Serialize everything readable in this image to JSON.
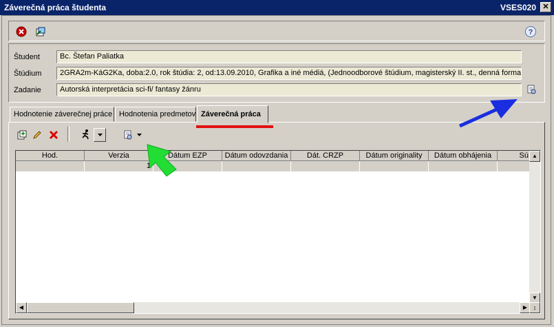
{
  "window": {
    "title": "Záverečná práca študenta",
    "code": "VSES020",
    "close_glyph": "✕"
  },
  "toolbar": {
    "icons": [
      "close-red-icon",
      "edit-icon",
      "help-icon"
    ]
  },
  "info": {
    "student_label": "Študent",
    "student_value": "Bc. Štefan Paliatka",
    "study_label": "Štúdium",
    "study_value": "2GRA2m-KáG2Ka, doba:2.0, rok štúdia: 2, od:13.09.2010, Grafika a iné médiá, (Jednoodborové štúdium, magisterský II. st., denná forma)",
    "assignment_label": "Zadanie",
    "assignment_value": "Autorská interpretácia sci-fi/ fantasy žánru"
  },
  "tabs": [
    {
      "label": "Hodnotenie záverečnej práce"
    },
    {
      "label": "Hodnotenia predmetov"
    },
    {
      "label": "Záverečná práca"
    }
  ],
  "grid": {
    "columns": [
      "Hod.",
      "Verzia",
      "Dátum EZP",
      "Dátum odovzdania",
      "Dát. CRZP",
      "Dátum originality",
      "Dátum obhájenia",
      "Sú"
    ],
    "rows": [
      [
        "",
        "1",
        "",
        "",
        "",
        "",
        "",
        ""
      ]
    ]
  },
  "colors": {
    "title_bg": "#0a246a",
    "field_bg": "#ecead5",
    "annotation_red": "#e01010",
    "annotation_blue": "#1a2ee0",
    "annotation_green": "#22dd33"
  }
}
